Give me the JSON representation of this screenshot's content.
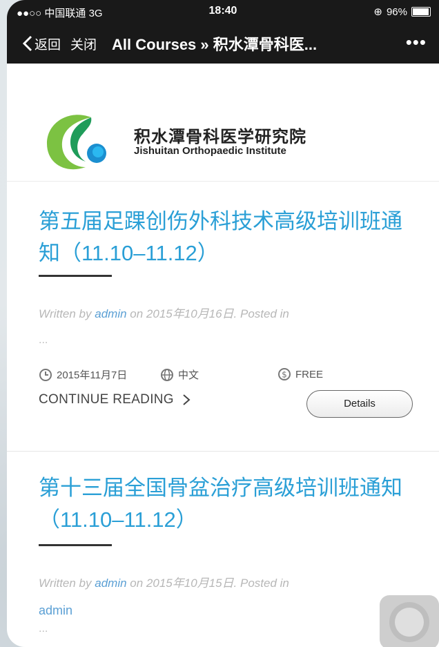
{
  "status_bar": {
    "carrier": "●●○○ 中国联通  3G",
    "time": "18:40",
    "battery": "96%",
    "battery_level": 0.96
  },
  "nav": {
    "back_label": "返回",
    "close_label": "关闭",
    "title": "All Courses » 积水潭骨科医...",
    "more_label": "•••"
  },
  "logo": {
    "name_cn": "积水潭骨科医学研究院",
    "name_en": "Jishuitan Orthopaedic Institute"
  },
  "posts": [
    {
      "title": "第五届足踝创伤外科技术高级培训班通知（11.10–11.12）",
      "meta_prefix": "Written by ",
      "author": "admin",
      "meta_suffix": " on 2015年10月16日. Posted in",
      "ellipsis": "...",
      "date": "2015年11月7日",
      "language": "中文",
      "price": "FREE",
      "continue_label": "CONTINUE READING",
      "details_label": "Details"
    },
    {
      "title": "第十三届全国骨盆治疗高级培训班通知（11.10–11.12）",
      "meta_prefix": "Written by ",
      "author": "admin",
      "meta_suffix": " on 2015年10月15日. Posted in",
      "category": "admin",
      "ellipsis": "..."
    }
  ],
  "colors": {
    "link_blue": "#2a9fd6",
    "bar_dark": "#191919"
  }
}
